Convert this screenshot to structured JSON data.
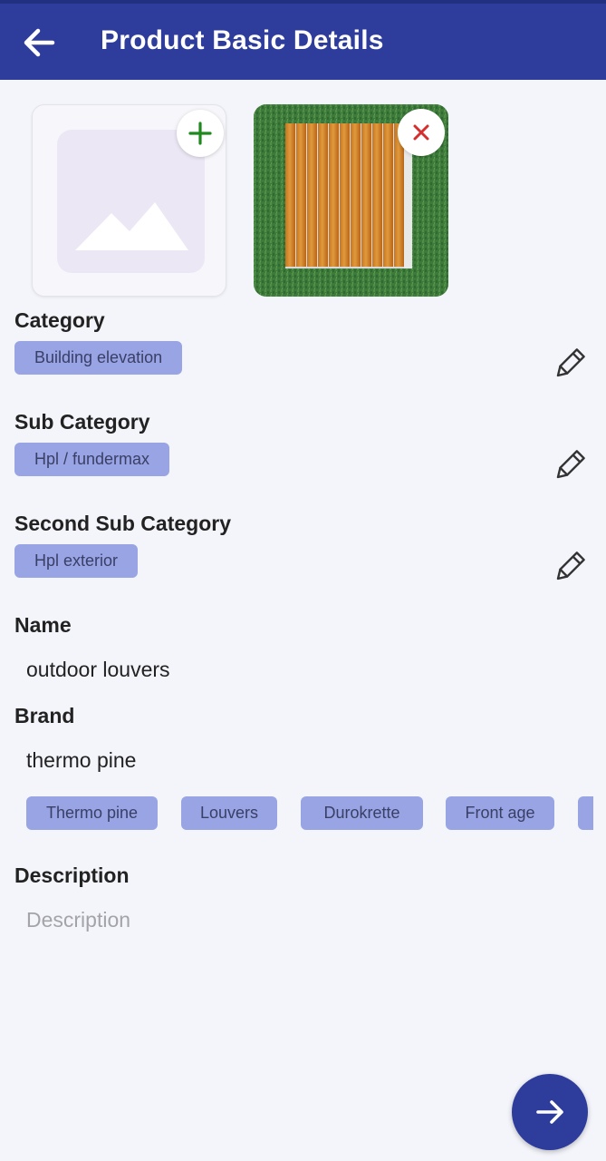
{
  "appbar": {
    "title": "Product Basic Details"
  },
  "category": {
    "label": "Category",
    "value": "Building elevation"
  },
  "sub_category": {
    "label": "Sub Category",
    "value": "Hpl / fundermax"
  },
  "second_sub_category": {
    "label": "Second Sub Category",
    "value": "Hpl exterior"
  },
  "name": {
    "label": "Name",
    "value": "outdoor louvers"
  },
  "brand": {
    "label": "Brand",
    "value": "thermo pine",
    "suggestions": [
      "Thermo pine",
      "Louvers",
      "Durokrette",
      "Front age",
      ""
    ]
  },
  "description": {
    "label": "Description",
    "placeholder": "Description"
  },
  "icons": {
    "back": "arrow-left-icon",
    "add_image": "plus-icon",
    "remove_image": "close-icon",
    "edit": "pencil-icon",
    "next": "arrow-right-icon"
  },
  "colors": {
    "appbar": "#2e3d9c",
    "chip": "#98a4e4",
    "add": "#1e8a1e",
    "remove": "#d32f2f"
  }
}
